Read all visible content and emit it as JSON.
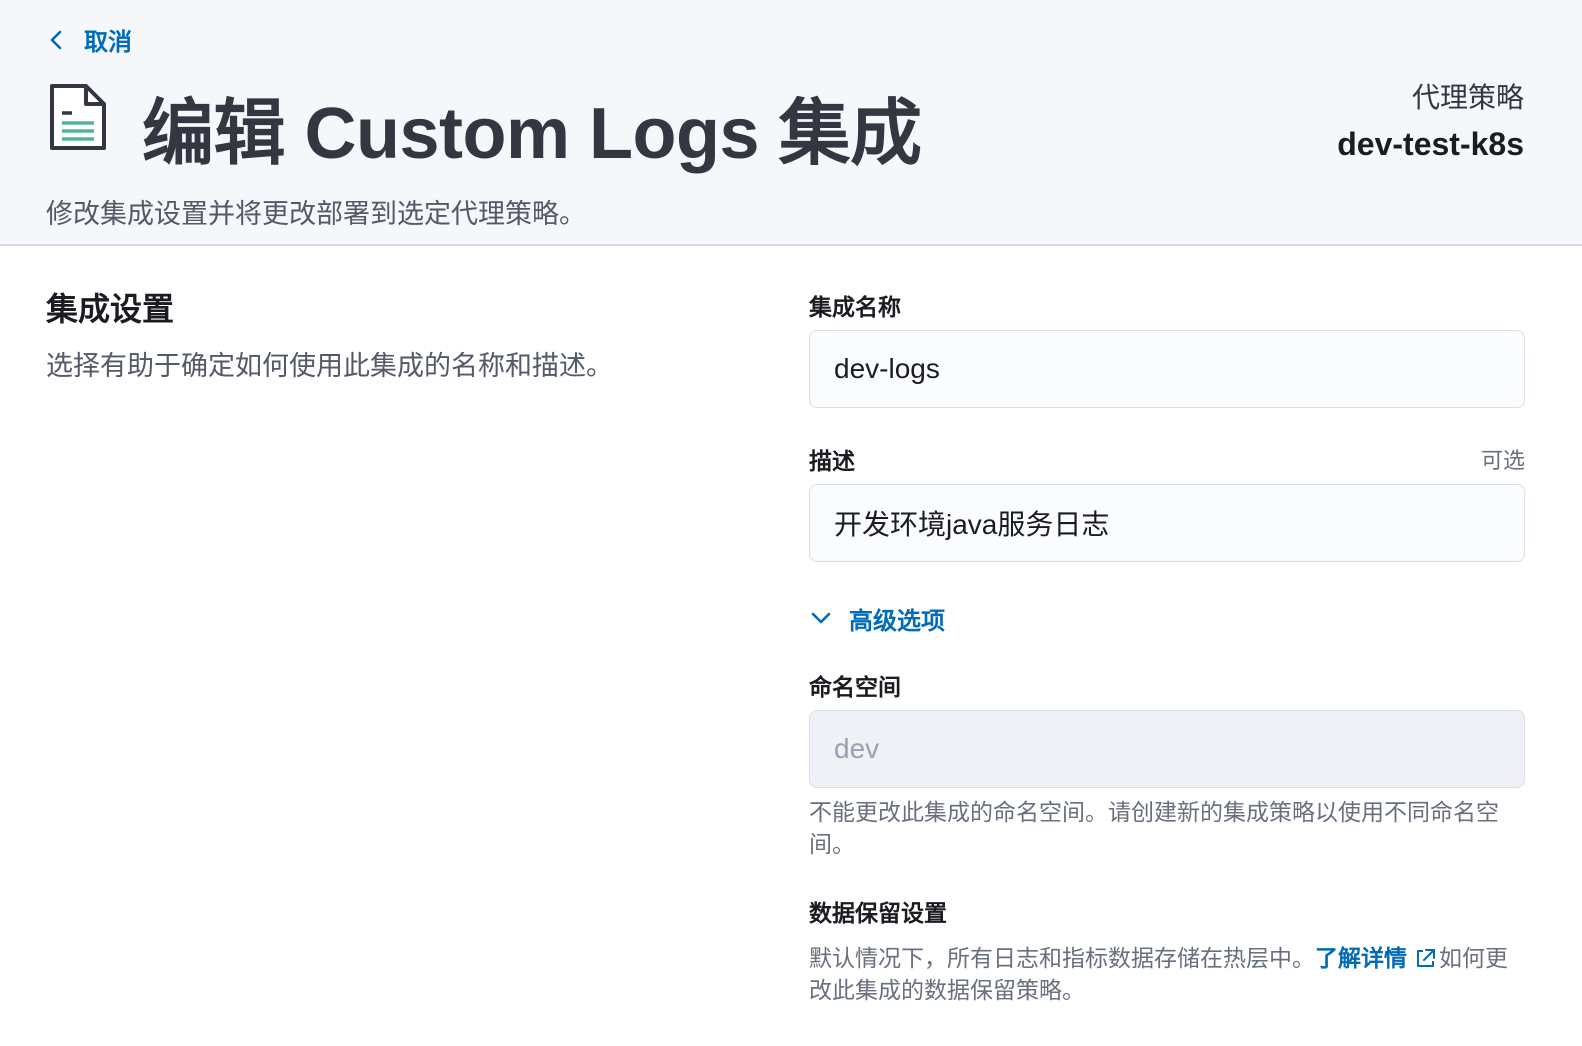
{
  "header": {
    "back_label": "取消",
    "title": "编辑 Custom Logs 集成",
    "description": "修改集成设置并将更改部署到选定代理策略。",
    "policy_label": "代理策略",
    "policy_value": "dev-test-k8s",
    "icon": "document-icon"
  },
  "section": {
    "title": "集成设置",
    "description": "选择有助于确定如何使用此集成的名称和描述。"
  },
  "form": {
    "name_label": "集成名称",
    "name_value": "dev-logs",
    "desc_label": "描述",
    "desc_optional": "可选",
    "desc_value": "开发环境java服务日志",
    "advanced_label": "高级选项",
    "namespace_label": "命名空间",
    "namespace_value": "dev",
    "namespace_help": "不能更改此集成的命名空间。请创建新的集成策略以使用不同命名空间。",
    "retention_label": "数据保留设置",
    "retention_help_before": "默认情况下，所有日志和指标数据存储在热层中。",
    "retention_link": "了解详情",
    "retention_help_after": "如何更改此集成的数据保留策略。"
  },
  "colors": {
    "accent": "#006bb8",
    "header_bg": "#f5f7fa",
    "icon_green": "#54b399"
  }
}
